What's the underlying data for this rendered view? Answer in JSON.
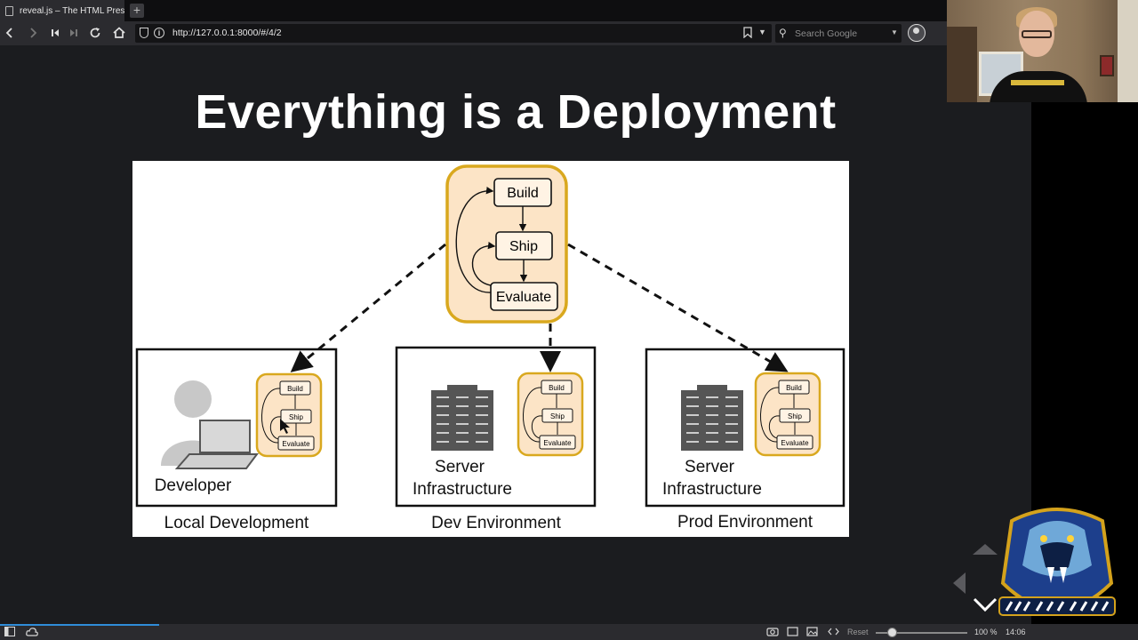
{
  "browser": {
    "tab_title": "reveal.js – The HTML Prese",
    "url": "http://127.0.0.1:8000/#/4/2",
    "search_placeholder": "Search Google"
  },
  "slide": {
    "title": "Everything is a Deployment",
    "diagram": {
      "central_cycle": [
        "Build",
        "Ship",
        "Evaluate"
      ],
      "environments": [
        {
          "label": "Local Development",
          "actor": "Developer",
          "cycle": [
            "Build",
            "Ship",
            "Evaluate"
          ]
        },
        {
          "label": "Dev Environment",
          "actor_line1": "Server",
          "actor_line2": "Infrastructure",
          "cycle": [
            "Build",
            "Ship",
            "Evaluate"
          ]
        },
        {
          "label": "Prod Environment",
          "actor_line1": "Server",
          "actor_line2": "Infrastructure",
          "cycle": [
            "Build",
            "Ship",
            "Evaluate"
          ]
        }
      ]
    }
  },
  "bottombar": {
    "reset_label": "Reset",
    "zoom": "100 %",
    "time": "14:06",
    "progress": 0.14
  },
  "colors": {
    "cycle_fill": "#fce4c6",
    "cycle_border": "#d9a81e",
    "accent_blue": "#2f8cd8"
  }
}
